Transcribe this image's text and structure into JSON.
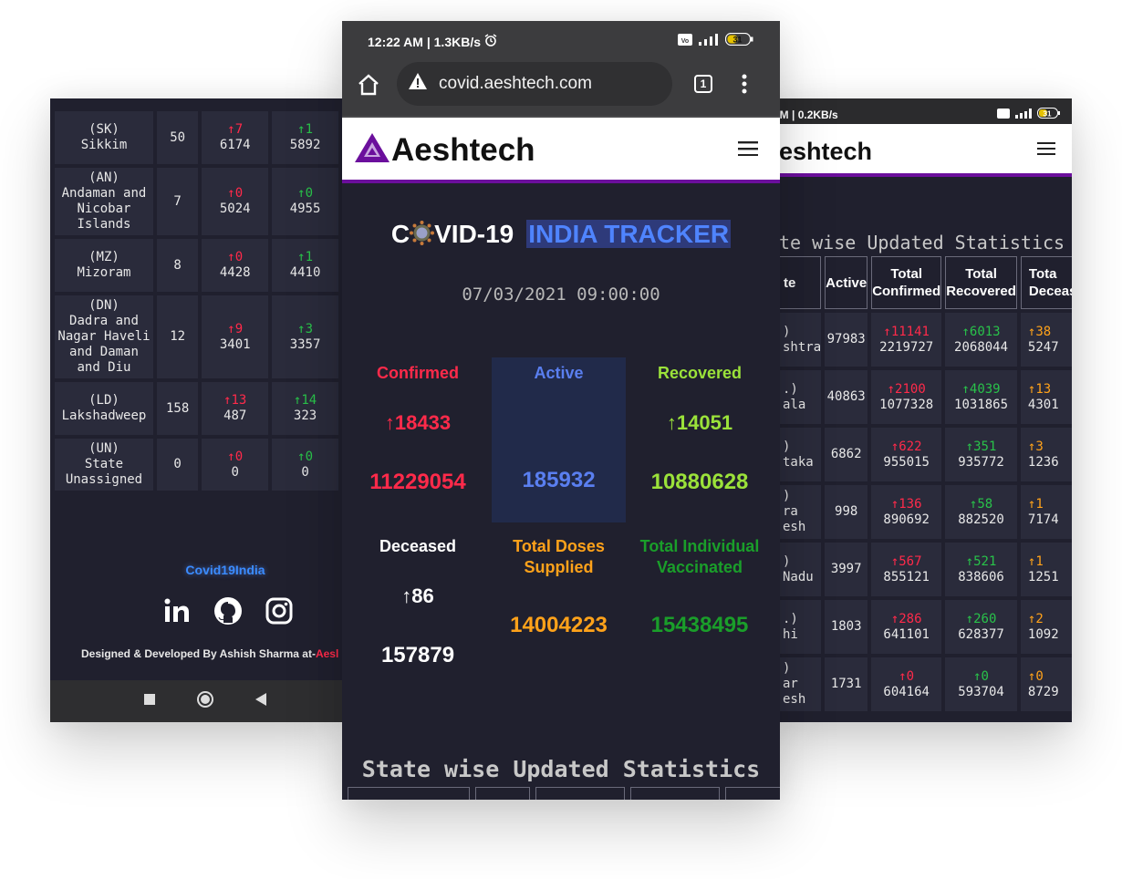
{
  "left": {
    "rows": [
      {
        "code": "(SK)",
        "name": "Sikkim",
        "active": "50",
        "c_delta": "↑7",
        "c_total": "6174",
        "r_delta": "↑1",
        "r_total": "5892"
      },
      {
        "code": "(AN)",
        "name": "Andaman and Nicobar Islands",
        "name_lines": [
          "Andaman and",
          "Nicobar",
          "Islands"
        ],
        "active": "7",
        "c_delta": "↑0",
        "c_total": "5024",
        "r_delta": "↑0",
        "r_total": "4955"
      },
      {
        "code": "(MZ)",
        "name": "Mizoram",
        "active": "8",
        "c_delta": "↑0",
        "c_total": "4428",
        "r_delta": "↑1",
        "r_total": "4410"
      },
      {
        "code": "(DN)",
        "name": "Dadra and Nagar Haveli and Daman and Diu",
        "name_lines": [
          "Dadra and",
          "Nagar Haveli",
          "and Daman",
          "and Diu"
        ],
        "active": "12",
        "c_delta": "↑9",
        "c_total": "3401",
        "r_delta": "↑3",
        "r_total": "3357"
      },
      {
        "code": "(LD)",
        "name": "Lakshadweep",
        "active": "158",
        "c_delta": "↑13",
        "c_total": "487",
        "r_delta": "↑14",
        "r_total": "323"
      },
      {
        "code": "(UN)",
        "name": "State Unassigned",
        "name_lines": [
          "State",
          "Unassigned"
        ],
        "active": "0",
        "c_delta": "↑0",
        "c_total": "0",
        "r_delta": "↑0",
        "r_total": "0"
      }
    ],
    "footer_link": "Covid19India",
    "social_icons": [
      "linkedin-icon",
      "github-icon",
      "instagram-icon"
    ],
    "credit_prefix": "Designed & Developed By Ashish Sharma at-",
    "credit_brand": "Aesl",
    "nav_icons": [
      "recents-square-icon",
      "home-circle-icon",
      "back-triangle-icon"
    ]
  },
  "center": {
    "status": {
      "time": "12:22 AM | 1.3KB/s",
      "battery": "31"
    },
    "url": "covid.aeshtech.com",
    "tab_count": "1",
    "logo": "Aeshtech",
    "title_pre": "C",
    "title_post": "VID-19",
    "title_highlight": "INDIA TRACKER",
    "date": "07/03/2021 09:00:00",
    "stats": {
      "confirmed": {
        "label": "Confirmed",
        "delta": "↑18433",
        "total": "11229054"
      },
      "active": {
        "label": "Active",
        "total": "185932"
      },
      "recovered": {
        "label": "Recovered",
        "delta": "↑14051",
        "total": "10880628"
      },
      "deceased": {
        "label": "Deceased",
        "delta": "↑86",
        "total": "157879"
      },
      "doses": {
        "label_l1": "Total Doses",
        "label_l2": "Supplied",
        "total": "14004223"
      },
      "vaccinated": {
        "label_l1": "Total Individual",
        "label_l2": "Vaccinated",
        "total": "15438495"
      }
    },
    "section_title": "State wise Updated Statistics"
  },
  "right": {
    "status": {
      "time": "AM | 0.2KB/s",
      "battery": "31"
    },
    "logo": "eshtech",
    "section_title": "te wise Updated Statistics",
    "headers": {
      "state": "te",
      "active": "Active",
      "confirmed_l1": "Total",
      "confirmed_l2": "Confirmed",
      "recovered_l1": "Total",
      "recovered_l2": "Recovered",
      "deceased_l1": "Tota",
      "deceased_l2": "Deceas"
    },
    "rows": [
      {
        "s1": ")",
        "s2": "shtra",
        "active": "97983",
        "c_delta": "↑11141",
        "c_total": "2219727",
        "r_delta": "↑6013",
        "r_total": "2068044",
        "d_delta": "↑38",
        "d_total": "5247"
      },
      {
        "s1": ".)",
        "s2": "ala",
        "active": "40863",
        "c_delta": "↑2100",
        "c_total": "1077328",
        "r_delta": "↑4039",
        "r_total": "1031865",
        "d_delta": "↑13",
        "d_total": "4301"
      },
      {
        "s1": ")",
        "s2": "taka",
        "active": "6862",
        "c_delta": "↑622",
        "c_total": "955015",
        "r_delta": "↑351",
        "r_total": "935772",
        "d_delta": "↑3",
        "d_total": "1236"
      },
      {
        "s1": ")",
        "s2": "ra",
        "s3": "esh",
        "active": "998",
        "c_delta": "↑136",
        "c_total": "890692",
        "r_delta": "↑58",
        "r_total": "882520",
        "d_delta": "↑1",
        "d_total": "7174"
      },
      {
        "s1": ")",
        "s2": "Nadu",
        "active": "3997",
        "c_delta": "↑567",
        "c_total": "855121",
        "r_delta": "↑521",
        "r_total": "838606",
        "d_delta": "↑1",
        "d_total": "1251"
      },
      {
        "s1": ".)",
        "s2": "hi",
        "active": "1803",
        "c_delta": "↑286",
        "c_total": "641101",
        "r_delta": "↑260",
        "r_total": "628377",
        "d_delta": "↑2",
        "d_total": "1092"
      },
      {
        "s1": ")",
        "s2": "ar",
        "s3": "esh",
        "active": "1731",
        "c_delta": "↑0",
        "c_total": "604164",
        "r_delta": "↑0",
        "r_total": "593704",
        "d_delta": "↑0",
        "d_total": "8729"
      }
    ]
  },
  "colors": {
    "bg": "#20202e",
    "cell": "#2a2b3b",
    "red": "#ff2a4a",
    "blue": "#4f84ff",
    "green_light": "#9be23a",
    "green": "#1a9e2a",
    "orange": "#ffa21a",
    "purple": "#6b0f9c"
  }
}
